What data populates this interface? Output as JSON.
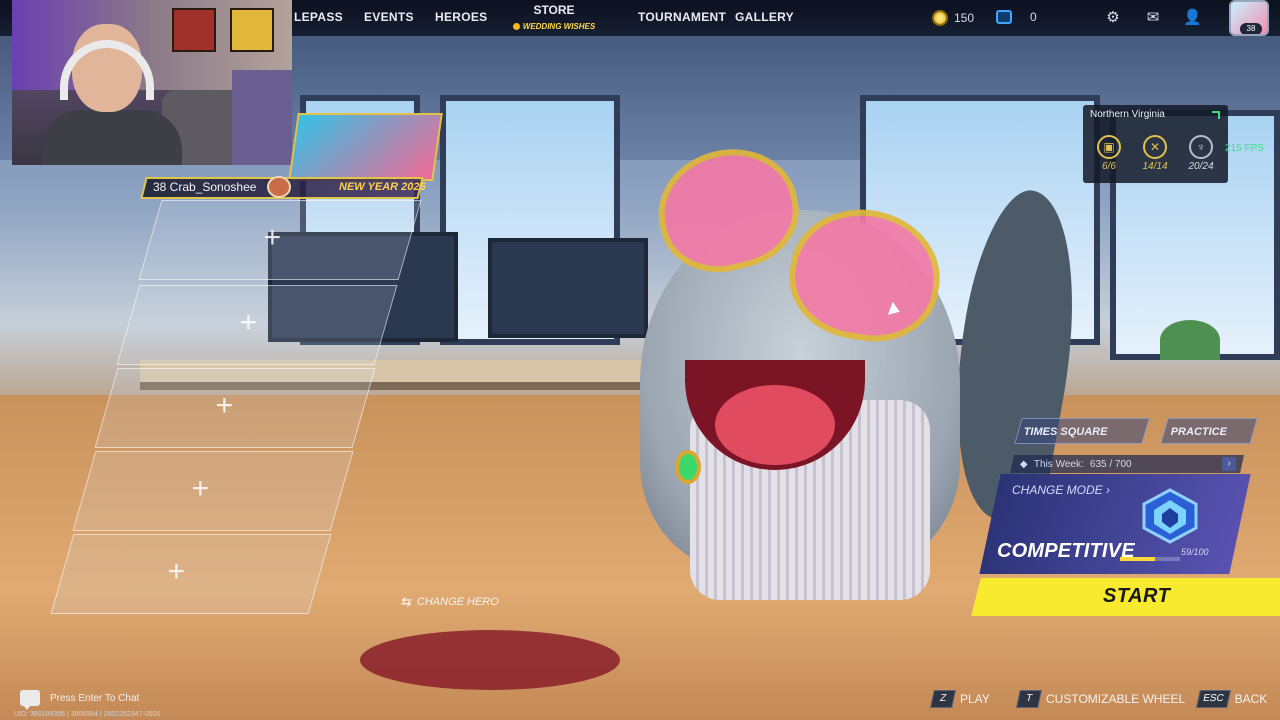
{
  "nav": {
    "items": [
      {
        "label": "LEPASS"
      },
      {
        "label": "EVENTS"
      },
      {
        "label": "HEROES"
      },
      {
        "label": "TOURNAMENT"
      },
      {
        "label": "GALLERY"
      }
    ],
    "store": {
      "label": "STORE",
      "promo": "WEDDING WISHES"
    },
    "currency_gold": "150",
    "currency_units": "0",
    "icons": [
      "settings-gear-icon",
      "mail-icon",
      "friends-icon"
    ],
    "avatar_level": "38"
  },
  "player": {
    "name": "38 Crab_Sonoshee",
    "event": "NEW YEAR 2026"
  },
  "server": {
    "region": "Northern Virginia",
    "stats": [
      {
        "value": "6/6",
        "icon": "clipboard-icon"
      },
      {
        "value": "14/14",
        "icon": "crossed-tools-icon"
      },
      {
        "value": "20/24",
        "icon": "trophy-icon"
      }
    ],
    "fps": "215 FPS"
  },
  "change_hero": "CHANGE HERO",
  "mode": {
    "map": "TIMES SQUARE",
    "practice": "PRACTICE",
    "this_week_label": "This Week:",
    "this_week_value": "635 / 700",
    "change_mode": "CHANGE MODE",
    "name": "COMPETITIVE",
    "progress_text": "59/100",
    "progress": 0.59,
    "start": "START"
  },
  "hints": [
    {
      "key": "Z",
      "label": "PLAY"
    },
    {
      "key": "T",
      "label": "CUSTOMIZABLE WHEEL"
    },
    {
      "key": "ESC",
      "label": "BACK"
    }
  ],
  "chat": {
    "label": "Press Enter To Chat"
  },
  "uid": "UID: 380189395 | 3006564 | 2602262347-0500",
  "colors": {
    "accent_yellow": "#f8ea2e",
    "fps_green": "#3fe38b",
    "gold": "#e2c14f",
    "mode_purple": "#4a4aa0"
  }
}
